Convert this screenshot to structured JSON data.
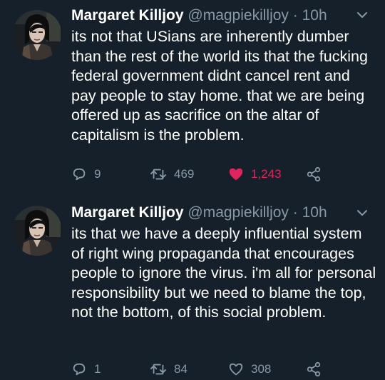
{
  "colors": {
    "background": "#15202b",
    "text": "#ffffff",
    "muted": "#8899a6",
    "like": "#e0245e"
  },
  "tweets": [
    {
      "name": "Margaret Killjoy",
      "handle": "@magpiekilljoy",
      "separator": "·",
      "time": "10h",
      "text": "its not that USians are inherently dumber than the rest of the world its that the fucking federal government didnt cancel rent and pay people to stay home. that we are being offered up as sacrifice on the altar of capitalism is the problem.",
      "replies": "9",
      "retweets": "469",
      "likes": "1,243",
      "liked": true,
      "icons": [
        "reply-icon",
        "retweet-icon",
        "heart-filled-icon",
        "share-icon",
        "chevron-down-icon"
      ]
    },
    {
      "name": "Margaret Killjoy",
      "handle": "@magpiekilljoy",
      "separator": "·",
      "time": "10h",
      "text": "its that we have a deeply influential system of right wing propaganda that encourages people to ignore the virus. i'm all for personal responsibility but we need to blame the top, not the bottom, of this social problem.",
      "replies": "1",
      "retweets": "84",
      "likes": "308",
      "liked": false,
      "icons": [
        "reply-icon",
        "retweet-icon",
        "heart-outline-icon",
        "share-icon",
        "chevron-down-icon"
      ]
    }
  ]
}
